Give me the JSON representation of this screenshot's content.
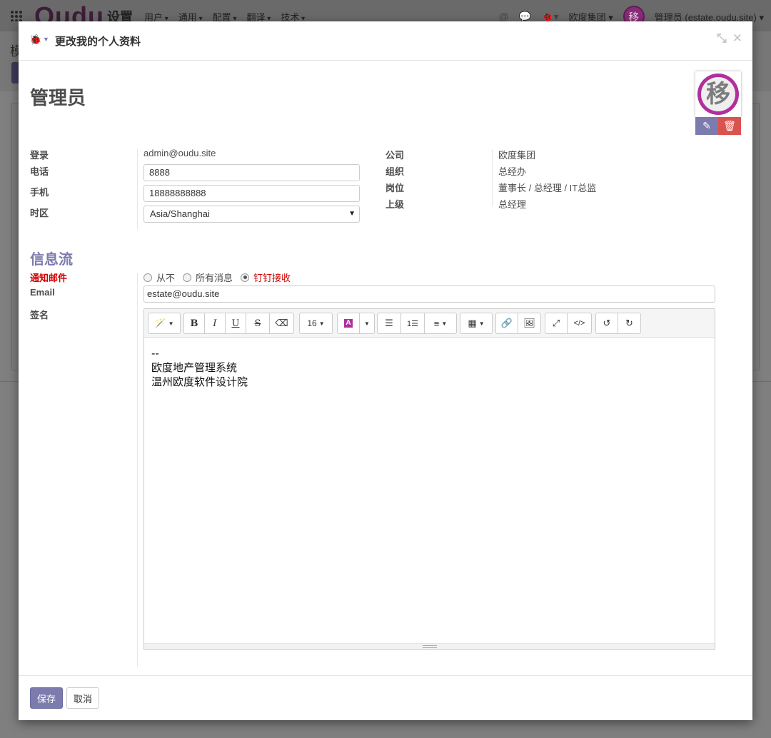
{
  "background": {
    "brand": "Oudu",
    "section": "设置",
    "menu": [
      "用户",
      "通用",
      "配置",
      "翻译",
      "技术"
    ],
    "company_switcher": "欧度集团",
    "user_label": "管理员 (estate.oudu.site)",
    "breadcrumb_initial": "模"
  },
  "modal": {
    "title": "更改我的个人资料",
    "user_name": "管理员",
    "avatar_char": "移",
    "fields_left": {
      "login_label": "登录",
      "login_value": "admin@oudu.site",
      "phone_label": "电话",
      "phone_value": "8888",
      "mobile_label": "手机",
      "mobile_value": "18888888888",
      "tz_label": "时区",
      "tz_value": "Asia/Shanghai"
    },
    "fields_right": {
      "company_label": "公司",
      "company_value": "欧度集团",
      "org_label": "组织",
      "org_value": "总经办",
      "position_label": "岗位",
      "position_value": "董事长 / 总经理 / IT总监",
      "manager_label": "上级",
      "manager_value": "总经理"
    },
    "section_title": "信息流",
    "notify_label": "通知邮件",
    "notify_options": [
      "从不",
      "所有消息",
      "钉钉接收"
    ],
    "notify_selected": "钉钉接收",
    "email_label": "Email",
    "email_value": "estate@oudu.site",
    "signature_label": "签名",
    "font_size": "16",
    "signature_lines": [
      "--",
      "欧度地产管理系统",
      "温州欧度软件设计院"
    ],
    "save_label": "保存",
    "cancel_label": "取消"
  },
  "colors": {
    "primary": "#7c7bad",
    "danger": "#d9534f",
    "required_label": "#d20000",
    "avatar_ring": "#b12f9d"
  }
}
